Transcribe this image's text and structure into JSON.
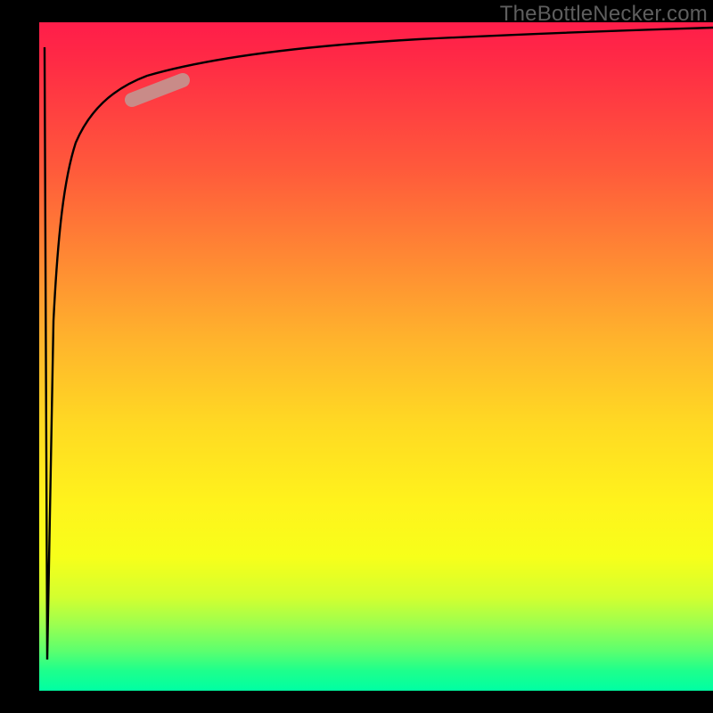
{
  "watermark": "TheBottleNecker.com",
  "chart_data": {
    "type": "line",
    "title": "",
    "xlabel": "",
    "ylabel": "",
    "xlim": [
      0,
      100
    ],
    "ylim": [
      0,
      100
    ],
    "background_gradient": {
      "top": "#ff1d4a",
      "mid": "#fff31c",
      "bottom": "#00ffa3"
    },
    "series": [
      {
        "name": "curve",
        "color": "#000000",
        "x": [
          0.7,
          1.0,
          1.4,
          2.0,
          3.0,
          5.0,
          8.0,
          12.0,
          18.0,
          25.0,
          35.0,
          50.0,
          70.0,
          100.0
        ],
        "y": [
          96.0,
          5.0,
          55.0,
          70.0,
          79.0,
          85.5,
          89.0,
          91.3,
          92.8,
          93.7,
          94.5,
          95.2,
          95.8,
          96.3
        ]
      }
    ],
    "highlight_segment": {
      "color": "#c98b88",
      "x_range": [
        13.0,
        21.0
      ],
      "note": "short thick marker on the curve"
    }
  }
}
